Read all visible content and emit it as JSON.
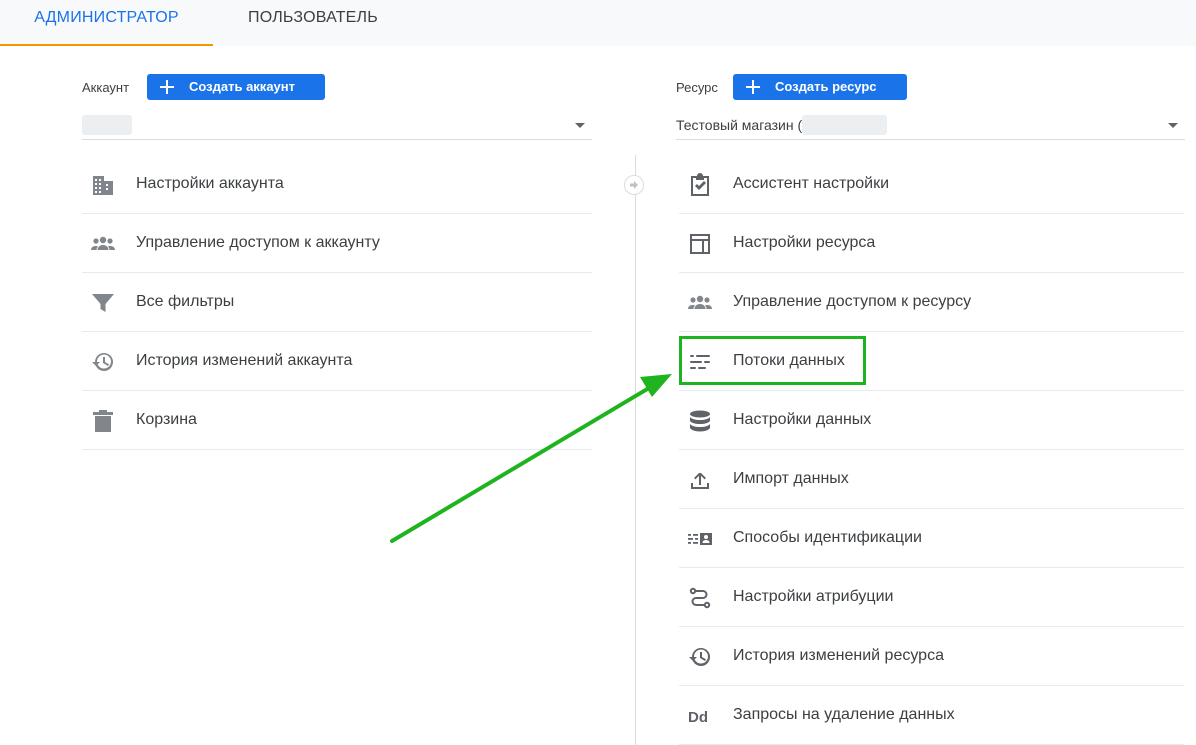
{
  "tabs": [
    {
      "label": "АДМИНИСТРАТОР",
      "active": true
    },
    {
      "label": "ПОЛЬЗОВАТЕЛЬ",
      "active": false
    }
  ],
  "account": {
    "label": "Аккаунт",
    "create_button": "Создать аккаунт",
    "selected_value": "",
    "items": [
      {
        "label": "Настройки аккаунта",
        "icon": "building-icon"
      },
      {
        "label": "Управление доступом к аккаунту",
        "icon": "people-icon"
      },
      {
        "label": "Все фильтры",
        "icon": "filter-icon"
      },
      {
        "label": "История изменений аккаунта",
        "icon": "history-icon"
      },
      {
        "label": "Корзина",
        "icon": "trash-icon"
      }
    ]
  },
  "property": {
    "label": "Ресурс",
    "create_button": "Создать ресурс",
    "selected_value": "Тестовый магазин (",
    "items": [
      {
        "label": "Ассистент настройки",
        "icon": "clipboard-check-icon"
      },
      {
        "label": "Настройки ресурса",
        "icon": "layout-icon"
      },
      {
        "label": "Управление доступом к ресурсу",
        "icon": "people-icon"
      },
      {
        "label": "Потоки данных",
        "icon": "data-streams-icon",
        "highlighted": true
      },
      {
        "label": "Настройки данных",
        "icon": "database-icon"
      },
      {
        "label": "Импорт данных",
        "icon": "upload-icon"
      },
      {
        "label": "Способы идентификации",
        "icon": "identity-icon"
      },
      {
        "label": "Настройки атрибуции",
        "icon": "attribution-icon"
      },
      {
        "label": "История изменений ресурса",
        "icon": "history-icon"
      },
      {
        "label": "Запросы на удаление данных",
        "icon": "dd-icon"
      }
    ]
  },
  "colors": {
    "accent": "#1a73e8",
    "tab_underline": "#f29900",
    "annotation": "#1fb41f",
    "icon": "#5f6368"
  }
}
